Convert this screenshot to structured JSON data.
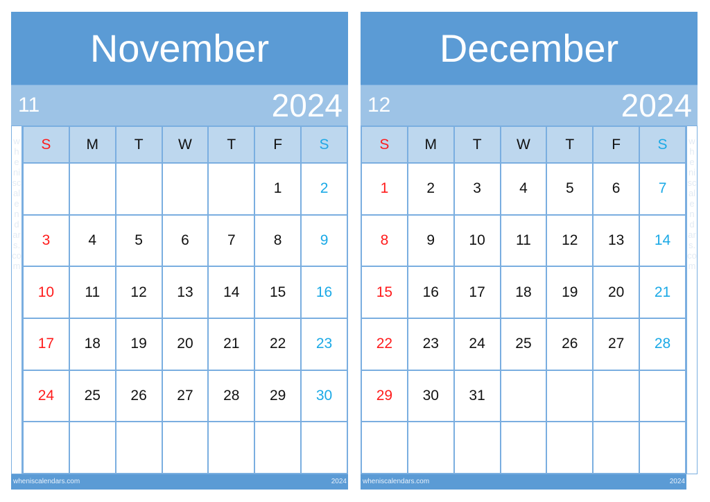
{
  "weekdays": [
    "S",
    "M",
    "T",
    "W",
    "T",
    "F",
    "S"
  ],
  "colors": {
    "title_band": "#5b9bd5",
    "year_band": "#9dc3e6",
    "weekday_row": "#bdd7ee",
    "sunday": "#ff1b1b",
    "saturday": "#1aa9e6",
    "grid_line": "#7aaee0"
  },
  "watermark": "wheniscalendars.com",
  "months": [
    {
      "name": "November",
      "number": "11",
      "year": "2024",
      "footer_site": "wheniscalendars.com",
      "footer_year": "2024",
      "weeks": [
        [
          "",
          "",
          "",
          "",
          "",
          "1",
          "2"
        ],
        [
          "3",
          "4",
          "5",
          "6",
          "7",
          "8",
          "9"
        ],
        [
          "10",
          "11",
          "12",
          "13",
          "14",
          "15",
          "16"
        ],
        [
          "17",
          "18",
          "19",
          "20",
          "21",
          "22",
          "23"
        ],
        [
          "24",
          "25",
          "26",
          "27",
          "28",
          "29",
          "30"
        ],
        [
          "",
          "",
          "",
          "",
          "",
          "",
          ""
        ]
      ]
    },
    {
      "name": "December",
      "number": "12",
      "year": "2024",
      "footer_site": "wheniscalendars.com",
      "footer_year": "2024",
      "weeks": [
        [
          "1",
          "2",
          "3",
          "4",
          "5",
          "6",
          "7"
        ],
        [
          "8",
          "9",
          "10",
          "11",
          "12",
          "13",
          "14"
        ],
        [
          "15",
          "16",
          "17",
          "18",
          "19",
          "20",
          "21"
        ],
        [
          "22",
          "23",
          "24",
          "25",
          "26",
          "27",
          "28"
        ],
        [
          "29",
          "30",
          "31",
          "",
          "",
          "",
          ""
        ],
        [
          "",
          "",
          "",
          "",
          "",
          "",
          ""
        ]
      ]
    }
  ]
}
